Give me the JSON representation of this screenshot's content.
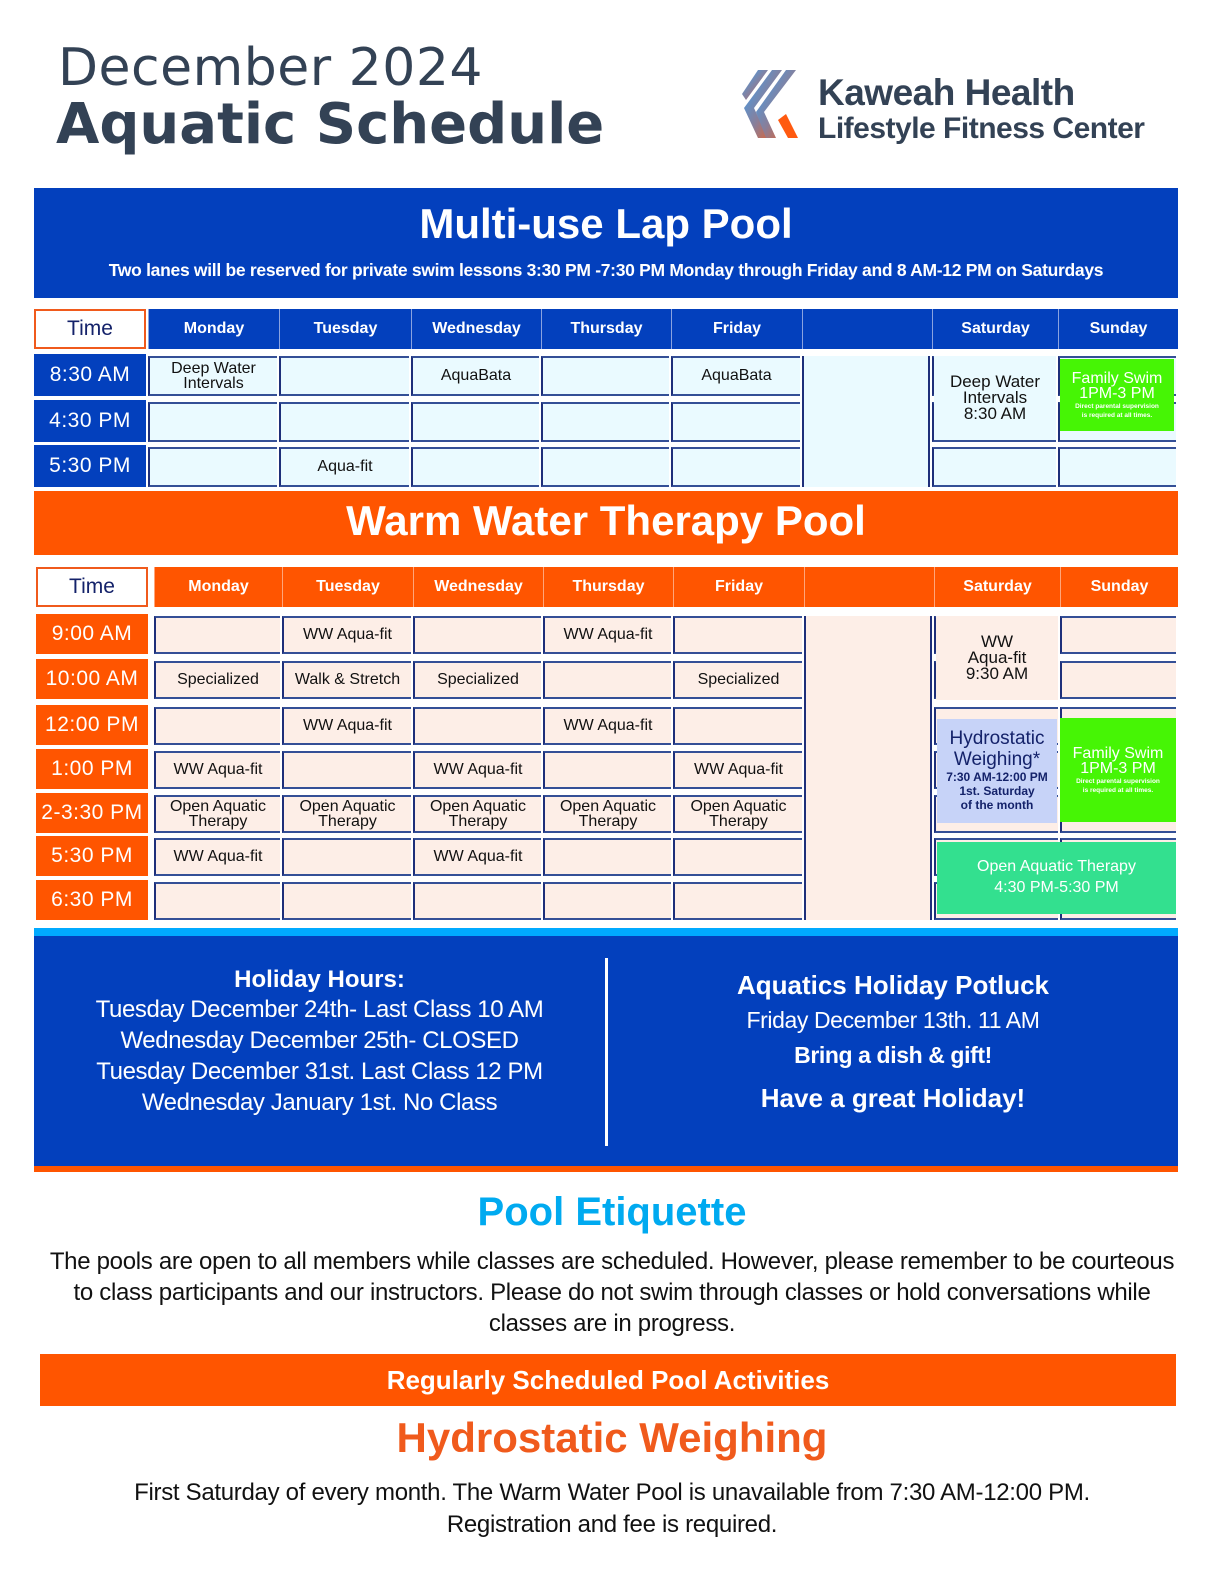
{
  "header": {
    "title_line1": "December 2024",
    "title_line2": "Aquatic Schedule",
    "logo": {
      "icon": "kaweah-health-logo-mark",
      "line1": "Kaweah Health",
      "line2": "Lifestyle Fitness Center"
    }
  },
  "colors": {
    "brand_blue": "#0340bd",
    "brand_orange": "#ff5500",
    "text_dark": "#334255",
    "family_swim_green": "#46f505",
    "open_aquatic_green": "#33e08f",
    "hydro_lavender": "#c7d3f8",
    "etiquette_cyan": "#00aaf0"
  },
  "lap_pool": {
    "title": "Multi-use Lap Pool",
    "subtitle": "Two lanes will be reserved for private swim lessons 3:30 PM -7:30 PM Monday through Friday and 8 AM-12 PM on Saturdays",
    "time_header": "Time",
    "days": [
      "Monday",
      "Tuesday",
      "Wednesday",
      "Thursday",
      "Friday",
      "",
      "Saturday",
      "Sunday"
    ],
    "rows": [
      {
        "time": "8:30 AM",
        "cells": [
          "Deep Water\nIntervals",
          "",
          "AquaBata",
          "",
          "AquaBata"
        ]
      },
      {
        "time": "4:30 PM",
        "cells": [
          "",
          "",
          "",
          "",
          ""
        ]
      },
      {
        "time": "5:30 PM",
        "cells": [
          "",
          "Aqua-fit",
          "",
          "",
          ""
        ]
      }
    ],
    "saturday_block": [
      "Deep Water",
      "Intervals",
      "8:30 AM"
    ],
    "sunday_block": {
      "title": "Family Swim",
      "time": "1PM-3 PM",
      "note_line1": "Direct parental supervision",
      "note_line2": "is required at all times."
    }
  },
  "therapy_pool": {
    "title": "Warm Water Therapy Pool",
    "time_header": "Time",
    "days": [
      "Monday",
      "Tuesday",
      "Wednesday",
      "Thursday",
      "Friday",
      "",
      "Saturday",
      "Sunday"
    ],
    "rows": [
      {
        "time": "9:00 AM",
        "cells": [
          "",
          "WW Aqua-fit",
          "",
          "WW Aqua-fit",
          ""
        ]
      },
      {
        "time": "10:00 AM",
        "cells": [
          "Specialized",
          "Walk & Stretch",
          "Specialized",
          "",
          "Specialized"
        ]
      },
      {
        "time": "12:00 PM",
        "cells": [
          "",
          "WW Aqua-fit",
          "",
          "WW Aqua-fit",
          ""
        ]
      },
      {
        "time": "1:00 PM",
        "cells": [
          "WW Aqua-fit",
          "",
          "WW Aqua-fit",
          "",
          "WW Aqua-fit"
        ]
      },
      {
        "time": "2-3:30 PM",
        "cells": [
          "Open Aquatic\nTherapy",
          "Open Aquatic\nTherapy",
          "Open Aquatic\nTherapy",
          "Open Aquatic\nTherapy",
          "Open Aquatic\nTherapy"
        ]
      },
      {
        "time": "5:30 PM",
        "cells": [
          "WW Aqua-fit",
          "",
          "WW Aqua-fit",
          "",
          ""
        ]
      },
      {
        "time": "6:30 PM",
        "cells": [
          "",
          "",
          "",
          "",
          ""
        ]
      }
    ],
    "saturday_aquafit": [
      "WW",
      "Aqua-fit",
      "9:30 AM"
    ],
    "hydrostatic": {
      "title_line1": "Hydrostatic",
      "title_line2": "Weighing*",
      "time": "7:30 AM-12:00 PM",
      "note_line1": "1st. Saturday",
      "note_line2": "of the month"
    },
    "sunday_family": {
      "title": "Family Swim",
      "time": "1PM-3 PM",
      "note_line1": "Direct parental supervision",
      "note_line2": "is required at all times."
    },
    "weekend_open_aquatic": {
      "title": "Open Aquatic Therapy",
      "time": "4:30 PM-5:30 PM"
    }
  },
  "holiday_hours": {
    "title": "Holiday Hours:",
    "lines": [
      "Tuesday December 24th- Last Class 10 AM",
      "Wednesday December 25th- CLOSED",
      "Tuesday December 31st. Last Class 12 PM",
      "Wednesday January 1st. No Class"
    ]
  },
  "potluck": {
    "title": "Aquatics Holiday Potluck",
    "date": "Friday December 13th. 11 AM",
    "bring": "Bring a dish & gift!",
    "greeting": "Have a great Holiday!"
  },
  "etiquette": {
    "title": "Pool Etiquette",
    "body": "The pools are open to all members while classes are scheduled. However, please remember to be courteous to class participants and our instructors. Please do not swim through classes or hold conversations while classes are in progress."
  },
  "regular_activities": {
    "banner": "Regularly Scheduled Pool Activities",
    "hydro_title": "Hydrostatic Weighing",
    "hydro_line1": "First Saturday of every month. The Warm Water Pool is unavailable from 7:30 AM-12:00 PM.",
    "hydro_line2": "Registration and fee is required."
  }
}
